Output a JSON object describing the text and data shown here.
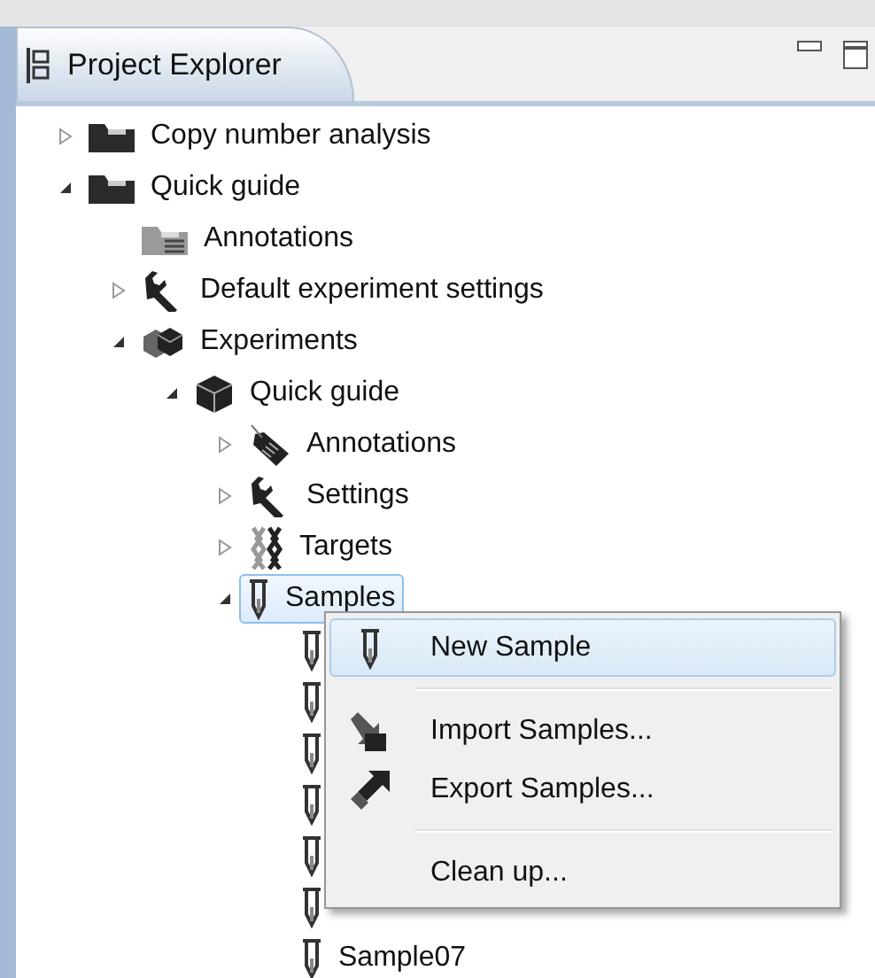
{
  "panel": {
    "title": "Project Explorer",
    "buttons": [
      {
        "kind": "minimize"
      },
      {
        "kind": "maximize"
      }
    ]
  },
  "tree": [
    {
      "label": "Copy number analysis",
      "kind": "folder",
      "expanded": false,
      "selected": false
    },
    {
      "label": "Quick guide",
      "kind": "folder",
      "expanded": true,
      "selected": false,
      "children": [
        {
          "label": "Annotations",
          "kind": "annotation-folder",
          "selected": false
        },
        {
          "label": "Default experiment settings",
          "kind": "wrench",
          "expanded": false,
          "selected": false
        },
        {
          "label": "Experiments",
          "kind": "boxes",
          "expanded": true,
          "selected": false,
          "children": [
            {
              "label": "Quick guide",
              "kind": "box",
              "expanded": true,
              "selected": false,
              "children": [
                {
                  "label": "Annotations",
                  "kind": "tag",
                  "expanded": false,
                  "selected": false
                },
                {
                  "label": "Settings",
                  "kind": "wrench",
                  "expanded": false,
                  "selected": false
                },
                {
                  "label": "Targets",
                  "kind": "targets",
                  "expanded": false,
                  "selected": false
                },
                {
                  "label": "Samples",
                  "kind": "tube",
                  "expanded": true,
                  "selected": true,
                  "children": [
                    {
                      "kind": "tube",
                      "selected": false
                    },
                    {
                      "kind": "tube",
                      "selected": false
                    },
                    {
                      "kind": "tube",
                      "selected": false
                    },
                    {
                      "kind": "tube",
                      "selected": false
                    },
                    {
                      "kind": "tube",
                      "selected": false
                    },
                    {
                      "kind": "tube",
                      "selected": false
                    },
                    {
                      "label": "Sample07",
                      "kind": "tube",
                      "selected": false
                    }
                  ]
                }
              ]
            }
          ]
        }
      ]
    }
  ],
  "context_menu": [
    {
      "kind": "new",
      "label": "New Sample",
      "selected": true
    },
    {
      "kind": "separator"
    },
    {
      "kind": "import",
      "label": "Import Samples...",
      "selected": false
    },
    {
      "kind": "export",
      "label": "Export Samples...",
      "selected": false
    },
    {
      "kind": "separator"
    },
    {
      "kind": "clean-up",
      "label": "Clean up...",
      "selected": false
    }
  ]
}
